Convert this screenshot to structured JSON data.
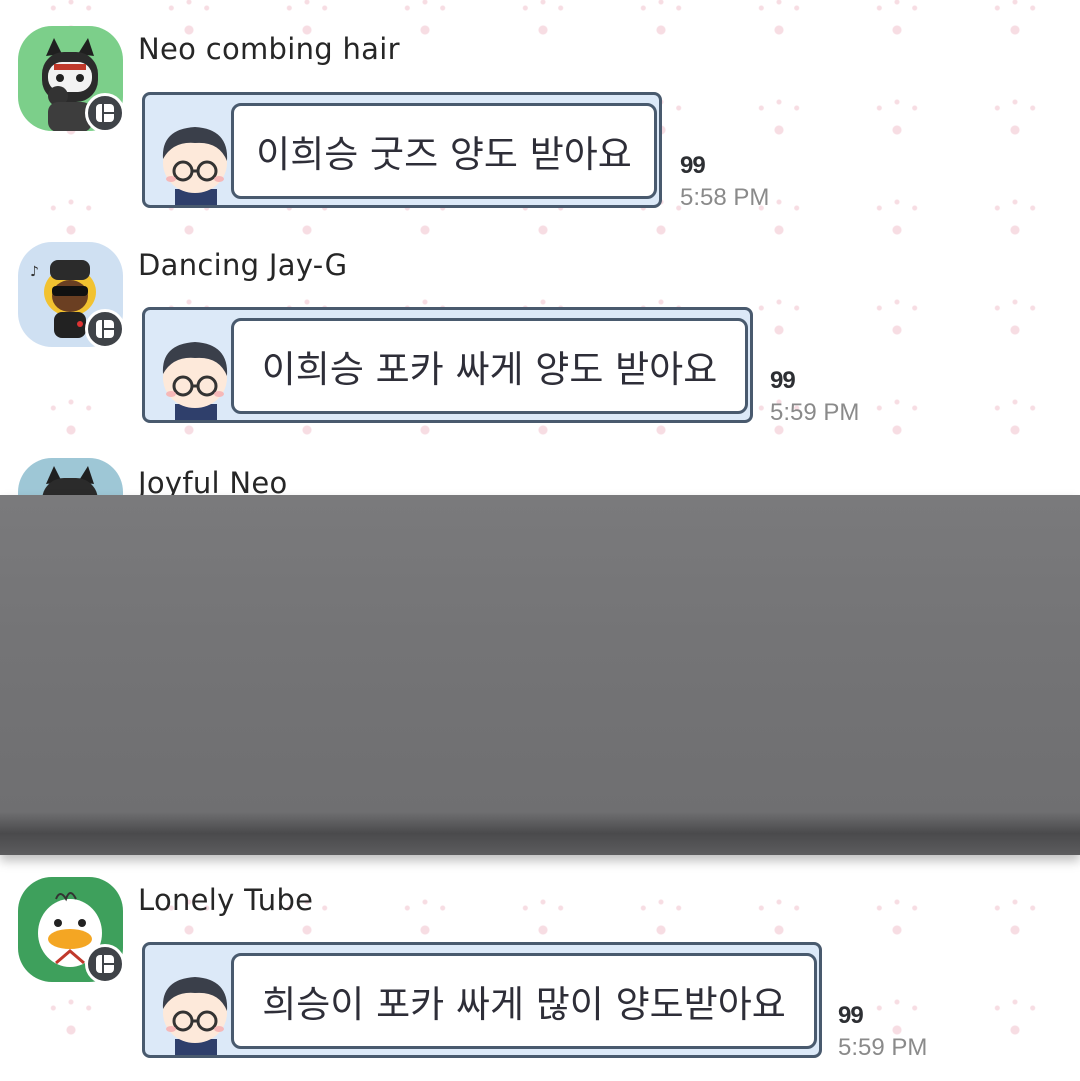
{
  "messages": [
    {
      "sender": "Neo combing hair",
      "avatar_icon": "neo-combing-hair-avatar-icon",
      "avatar_bg": "#7ccf8a",
      "text": "이희승 굿즈 양도 받아요",
      "unread": "99",
      "time": "5:58 PM"
    },
    {
      "sender": "Dancing Jay-G",
      "avatar_icon": "dancing-jay-g-avatar-icon",
      "avatar_bg": "#cfe0f2",
      "text": "이희승 포카 싸게 양도 받아요",
      "unread": "99",
      "time": "5:59 PM"
    },
    {
      "sender": "Joyful Neo",
      "avatar_icon": "joyful-neo-avatar-icon",
      "avatar_bg": "#9ec7d6"
    },
    {
      "sender": "Lonely Tube",
      "avatar_icon": "lonely-tube-avatar-icon",
      "avatar_bg": "#3ea05c",
      "text": "희승이 포카 싸게 많이 양도받아요",
      "unread": "99",
      "time": "5:59 PM"
    }
  ],
  "colors": {
    "bubble_border": "#495a6e",
    "bubble_fill": "#dce9f8",
    "overlay": "#747476",
    "time_text": "#8a8a8a"
  }
}
